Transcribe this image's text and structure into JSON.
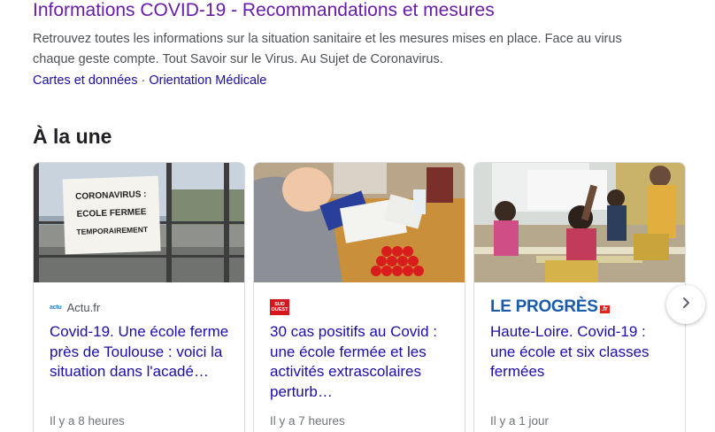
{
  "result": {
    "title": "Informations COVID-19 - Recommandations et mesures",
    "snippet": "Retrouvez toutes les informations sur la situation sanitaire et les mesures mises en place. Face au virus chaque geste compte. Tout Savoir sur le Virus. Au Sujet de Coronavirus.",
    "sitelinks": [
      "Cartes et données",
      "Orientation Médicale"
    ],
    "sitelink_separator": "·"
  },
  "top_stories": {
    "heading": "À la une",
    "cards": [
      {
        "source": "Actu.fr",
        "logo_text": "actu",
        "image_sign_lines": [
          "CORONAVIRUS :",
          "ECOLE FERMEE",
          "TEMPORAIREMENT"
        ],
        "headline": "Covid-19. Une école ferme près de Toulouse : voici la situation dans l'acadé…",
        "time": "Il y a 8 heures"
      },
      {
        "source": "Sud Ouest",
        "logo_lines": [
          "SUD",
          "OUEST"
        ],
        "headline": "30 cas positifs au Covid : une école fermée et les activités extrascolaires perturb…",
        "time": "Il y a 7 heures"
      },
      {
        "source": "Le Progrès",
        "logo_word": "LE PROGRÈS",
        "logo_suffix": ".fr",
        "headline": "Haute-Loire. Covid-19 : une école et six classes fermées",
        "time": "Il y a 1 jour"
      }
    ],
    "next_icon": "chevron-right-icon"
  },
  "colors": {
    "visited_title": "#681da8",
    "link": "#1a0dab",
    "snippet": "#4d5156",
    "meta": "#70757a"
  }
}
